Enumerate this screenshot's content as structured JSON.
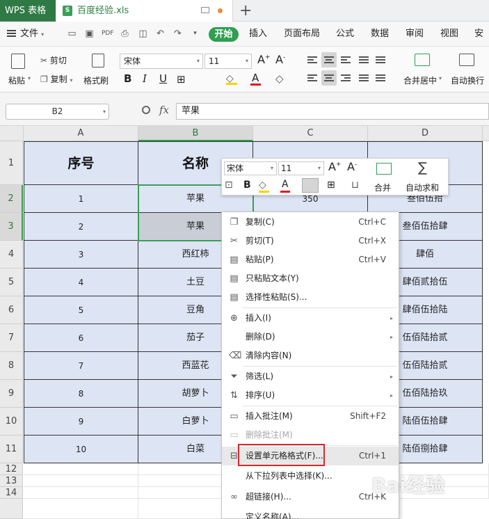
{
  "titlebar": {
    "app_name": "WPS 表格",
    "file_name": "百度经验.xls",
    "new_tab": "+"
  },
  "menubar": {
    "file": "文件",
    "tabs": [
      "开始",
      "插入",
      "页面布局",
      "公式",
      "数据",
      "审阅",
      "视图",
      "安全"
    ]
  },
  "ribbon": {
    "paste": "粘贴",
    "cut": "剪切",
    "copy": "复制",
    "format_painter": "格式刷",
    "font": "宋体",
    "size": "11",
    "merge_center": "合并居中",
    "wrap_text": "自动换行"
  },
  "formula_bar": {
    "name_box": "B2",
    "fx": "fx",
    "content": "苹果"
  },
  "sheet": {
    "columns": [
      "A",
      "B",
      "C",
      "D"
    ],
    "rows": [
      "1",
      "2",
      "3",
      "4",
      "5",
      "6",
      "7",
      "8",
      "9",
      "10",
      "11",
      "12",
      "13",
      "14"
    ],
    "header_row": [
      "序号",
      "名称",
      "",
      ""
    ],
    "data": [
      [
        "1",
        "苹果",
        "350",
        "叁佰伍拾"
      ],
      [
        "2",
        "苹果",
        "",
        "叁佰伍拾肆"
      ],
      [
        "3",
        "西红柿",
        "",
        "肆佰"
      ],
      [
        "4",
        "土豆",
        "",
        "肆佰贰拾伍"
      ],
      [
        "5",
        "豆角",
        "",
        "肆佰伍拾陆"
      ],
      [
        "6",
        "茄子",
        "",
        "伍佰陆拾贰"
      ],
      [
        "7",
        "西蓝花",
        "",
        "伍佰陆拾贰"
      ],
      [
        "8",
        "胡萝卜",
        "",
        "伍佰陆拾玖"
      ],
      [
        "9",
        "白萝卜",
        "",
        "陆佰伍拾肆"
      ],
      [
        "10",
        "白菜",
        "",
        "陆佰捌拾肆"
      ]
    ]
  },
  "mini_toolbar": {
    "font": "宋体",
    "size": "11",
    "merge": "合并",
    "autosum": "自动求和"
  },
  "context_menu": [
    {
      "label": "复制(C)",
      "shortcut": "Ctrl+C",
      "icon": "copy-icon"
    },
    {
      "label": "剪切(T)",
      "shortcut": "Ctrl+X",
      "icon": "scissors-icon"
    },
    {
      "label": "粘贴(P)",
      "shortcut": "Ctrl+V",
      "icon": "paste-icon"
    },
    {
      "label": "只粘贴文本(Y)",
      "shortcut": "",
      "icon": "paste-text-icon"
    },
    {
      "label": "选择性粘贴(S)...",
      "shortcut": "",
      "icon": "paste-special-icon"
    },
    {
      "label": "插入(I)",
      "shortcut": "",
      "icon": "insert-icon"
    },
    {
      "label": "删除(D)",
      "shortcut": "",
      "icon": ""
    },
    {
      "label": "清除内容(N)",
      "shortcut": "",
      "icon": "eraser-icon"
    },
    {
      "label": "筛选(L)",
      "shortcut": "",
      "icon": "filter-icon"
    },
    {
      "label": "排序(U)",
      "shortcut": "",
      "icon": "sort-icon"
    },
    {
      "label": "插入批注(M)",
      "shortcut": "Shift+F2",
      "icon": "comment-icon"
    },
    {
      "label": "删除批注(M)",
      "shortcut": "",
      "icon": "delete-comment-icon"
    },
    {
      "label": "设置单元格格式(F)...",
      "shortcut": "Ctrl+1",
      "icon": "format-cells-icon"
    },
    {
      "label": "从下拉列表中选择(K)...",
      "shortcut": "",
      "icon": ""
    },
    {
      "label": "超链接(H)...",
      "shortcut": "Ctrl+K",
      "icon": "link-icon"
    },
    {
      "label": "定义名称(A)...",
      "shortcut": "",
      "icon": ""
    }
  ],
  "watermark": "Bai经验",
  "colors": {
    "accent_green": "#2f9f50",
    "cell_fill": "#dde5f5",
    "highlight_red": "#d8282d"
  }
}
